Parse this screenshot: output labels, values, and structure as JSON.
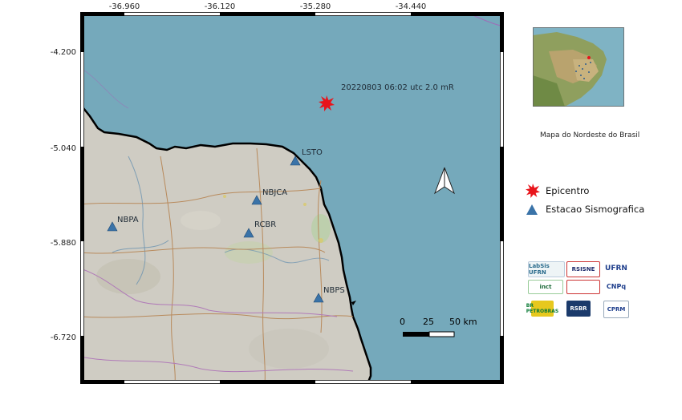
{
  "axes": {
    "top_ticks": [
      "-36.960",
      "-36.120",
      "-35.280",
      "-34.440"
    ],
    "left_ticks": [
      "-4.200",
      "-5.040",
      "-5.880",
      "-6.720"
    ]
  },
  "event": {
    "label": "20220803 06:02 utc 2.0 mR",
    "color": "#e8141b"
  },
  "stations": [
    {
      "name": "LSTO"
    },
    {
      "name": "NBJCA"
    },
    {
      "name": "NBPA"
    },
    {
      "name": "RCBR"
    },
    {
      "name": "NBPS"
    }
  ],
  "scale_bar": {
    "labels": [
      "0",
      "25",
      "50 km"
    ]
  },
  "inset": {
    "caption": "Mapa do Nordeste do  Brasil"
  },
  "legend": {
    "epicenter": "Epicentro",
    "station": "Estacao Sismografica",
    "station_color": "#3a73a8"
  },
  "logos": [
    "LabSis UFRN",
    "RSISNE",
    "UFRN",
    "inct",
    "CNPq",
    "BR PETROBRAS",
    "RSBR",
    "CPRM"
  ],
  "colors": {
    "ocean": "#75a9bb",
    "land": "#cfccc3",
    "coast": "#000000"
  }
}
